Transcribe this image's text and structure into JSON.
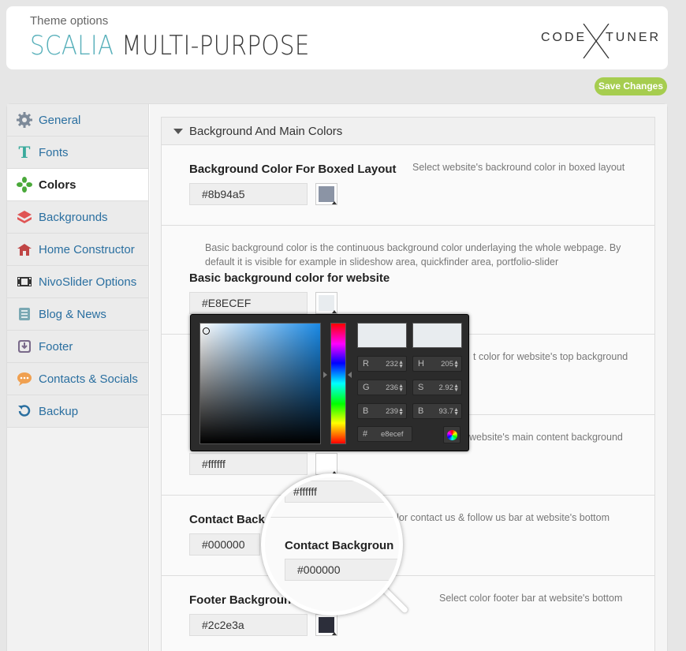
{
  "header": {
    "subtitle": "Theme options",
    "title_accent": "SCALIA",
    "title_rest": "MULTI-PURPOSE",
    "logo_left": "CODE",
    "logo_right": "TUNER"
  },
  "save_label": "Save Changes",
  "sidebar": {
    "items": [
      {
        "label": "General",
        "icon": "gear-icon"
      },
      {
        "label": "Fonts",
        "icon": "font-icon"
      },
      {
        "label": "Colors",
        "icon": "palette-icon",
        "active": true
      },
      {
        "label": "Backgrounds",
        "icon": "layers-icon"
      },
      {
        "label": "Home Constructor",
        "icon": "house-icon"
      },
      {
        "label": "NivoSlider Options",
        "icon": "film-icon"
      },
      {
        "label": "Blog & News",
        "icon": "list-icon"
      },
      {
        "label": "Footer",
        "icon": "download-icon"
      },
      {
        "label": "Contacts & Socials",
        "icon": "chat-icon"
      },
      {
        "label": "Backup",
        "icon": "restore-icon"
      }
    ]
  },
  "section_title": "Background And Main Colors",
  "fields": {
    "boxed": {
      "label": "Background Color For Boxed Layout",
      "desc": "Select website's backround color in boxed layout",
      "value": "#8b94a5",
      "color": "#8b94a5"
    },
    "basic": {
      "desc": "Basic background color is the continuous background color underlaying the whole webpage. By default it is visible for example in slideshow area, quickfinder area, portfolio-slider",
      "label": "Basic background color for website",
      "value": "#E8ECEF",
      "color": "#e8ecef"
    },
    "top": {
      "desc": "t color for website's top background"
    },
    "main": {
      "desc": "website's main content background",
      "value": "#ffffff",
      "color": "#ffffff"
    },
    "contact": {
      "label": "Contact Back",
      "desc": "t color contact us & follow us bar at website's bottom",
      "value": "#000000"
    },
    "footer": {
      "label": "Footer Backgroun",
      "desc": "Select color footer bar at website's bottom",
      "value": "#2c2e3a",
      "color": "#2c2e3a"
    }
  },
  "picker": {
    "new_color": "#e8ecef",
    "current_color": "#e8ecef",
    "r_label": "R",
    "r": "232",
    "g_label": "G",
    "g": "236",
    "b_label": "B",
    "b": "239",
    "h_label": "H",
    "h": "205",
    "s_label": "S",
    "s": "2.92",
    "bv_label": "B",
    "bv": "93.7",
    "hex_label": "#",
    "hex": "e8ecef"
  },
  "magnifier": {
    "value1": "#ffffff",
    "label": "Contact Backgroun",
    "value2": "#000000"
  }
}
